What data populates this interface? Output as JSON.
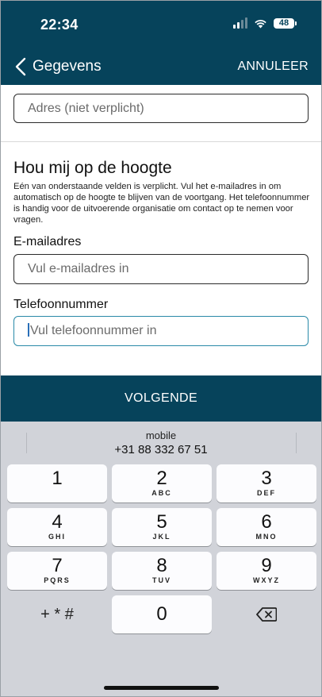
{
  "status_bar": {
    "time": "22:34",
    "battery": "48"
  },
  "nav": {
    "back_label": "Gegevens",
    "cancel_label": "ANNULEER"
  },
  "form": {
    "address_placeholder": "Adres (niet verplicht)",
    "section_title": "Hou mij op de hoogte",
    "section_description": "Eén van onderstaande velden is verplicht. Vul het e-mailadres in om automatisch op de hoogte te blijven van de voortgang. Het telefoonnummer is handig voor de uitvoerende organisatie om contact op te nemen voor vragen.",
    "email_label": "E-mailadres",
    "email_placeholder": "Vul e-mailadres in",
    "phone_label": "Telefoonnummer",
    "phone_placeholder": "Vul telefoonnummer in"
  },
  "next_button": "VOLGENDE",
  "keyboard": {
    "suggestion_label": "mobile",
    "suggestion_value": "+31 88 332 67 51",
    "keys": [
      {
        "num": "1",
        "letters": ""
      },
      {
        "num": "2",
        "letters": "ABC"
      },
      {
        "num": "3",
        "letters": "DEF"
      },
      {
        "num": "4",
        "letters": "GHI"
      },
      {
        "num": "5",
        "letters": "JKL"
      },
      {
        "num": "6",
        "letters": "MNO"
      },
      {
        "num": "7",
        "letters": "PQRS"
      },
      {
        "num": "8",
        "letters": "TUV"
      },
      {
        "num": "9",
        "letters": "WXYZ"
      }
    ],
    "symbols": "+ * #",
    "zero": "0"
  },
  "icons": {
    "back": "chevron-left-icon",
    "signal": "cellular-signal-icon",
    "wifi": "wifi-icon",
    "battery": "battery-icon",
    "delete": "backspace-icon"
  },
  "colors": {
    "primary": "#06435b",
    "focus_border": "#2a8aa8",
    "keyboard_bg": "#d1d3d9"
  }
}
